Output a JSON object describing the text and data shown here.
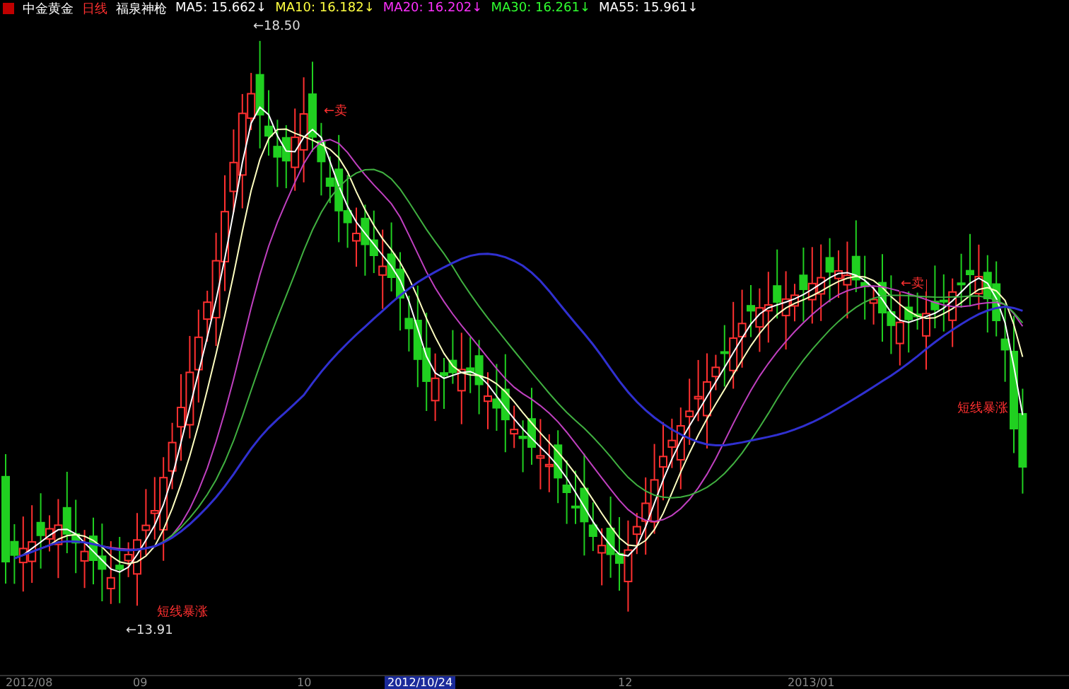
{
  "header": {
    "items": [
      {
        "text": "中金黄金",
        "color": "#ffffff"
      },
      {
        "text": "日线",
        "color": "#ff3030"
      },
      {
        "text": "福泉神枪",
        "color": "#ffffff"
      }
    ],
    "indicators": [
      {
        "text": "MA5: 15.662↓",
        "color": "#ffffff"
      },
      {
        "text": "MA10: 16.182↓",
        "color": "#ffff40"
      },
      {
        "text": "MA20: 16.202↓",
        "color": "#ff30ff"
      },
      {
        "text": "MA30: 16.261↓",
        "color": "#30ff30"
      },
      {
        "text": "MA55: 15.961↓",
        "color": "#ffffff"
      }
    ]
  },
  "chart": {
    "annotations": [
      {
        "text": "←18.50",
        "kind": "price"
      },
      {
        "text": "←13.91",
        "kind": "price"
      },
      {
        "text": "←卖",
        "kind": "signal"
      },
      {
        "text": "←卖",
        "kind": "signal"
      },
      {
        "text": "短线暴涨",
        "kind": "signal"
      },
      {
        "text": "短线暴涨",
        "kind": "signal"
      }
    ]
  },
  "axis": {
    "labels": [
      {
        "text": "2012/08",
        "selected": false
      },
      {
        "text": "09",
        "selected": false
      },
      {
        "text": "10",
        "selected": false
      },
      {
        "text": "2012/10/24",
        "selected": true
      },
      {
        "text": "12",
        "selected": false
      },
      {
        "text": "2013/01",
        "selected": false
      }
    ]
  }
}
